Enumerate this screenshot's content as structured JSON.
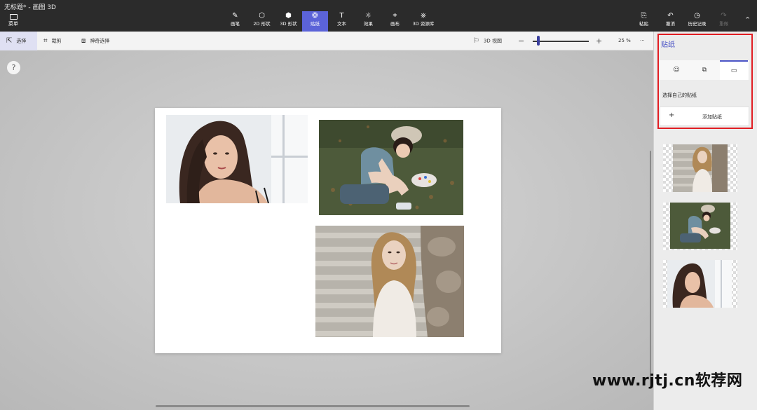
{
  "app": {
    "title": "无标题* - 画图 3D",
    "menu_label": "菜单"
  },
  "toolbar": {
    "tools": [
      {
        "label": "画笔",
        "icon": "brush-icon",
        "glyph": "✎"
      },
      {
        "label": "2D 形状",
        "icon": "shapes-2d-icon",
        "glyph": "⬡"
      },
      {
        "label": "3D 形状",
        "icon": "cube-icon",
        "glyph": "⬢"
      },
      {
        "label": "贴纸",
        "icon": "sticker-icon",
        "glyph": "❂"
      },
      {
        "label": "文本",
        "icon": "text-icon",
        "glyph": "T"
      },
      {
        "label": "效果",
        "icon": "effects-icon",
        "glyph": "☼"
      },
      {
        "label": "画布",
        "icon": "canvas-icon",
        "glyph": "⌗"
      },
      {
        "label": "3D 资源库",
        "icon": "library-3d-icon",
        "glyph": "⎈"
      }
    ],
    "active_tool": "贴纸",
    "right_tools": [
      {
        "label": "粘贴",
        "icon": "paste-icon",
        "glyph": "⎘"
      },
      {
        "label": "撤消",
        "icon": "undo-icon",
        "glyph": "↶"
      },
      {
        "label": "历史记录",
        "icon": "history-icon",
        "glyph": "◷"
      },
      {
        "label": "重做",
        "icon": "redo-icon",
        "glyph": "↷"
      }
    ]
  },
  "subtoolbar": {
    "select_label": "选择",
    "crop_label": "裁剪",
    "magic_select_label": "神奇选择",
    "view_3d_label": "3D 视图",
    "zoom_percent": "25 %",
    "zoom_minus": "−",
    "zoom_plus": "+",
    "more": "···"
  },
  "help": {
    "label": "?"
  },
  "panel": {
    "title": "贴纸",
    "tabs": [
      {
        "name": "stickers",
        "icon": "sticker-tab-icon",
        "glyph": "☺"
      },
      {
        "name": "textures",
        "icon": "texture-tab-icon",
        "glyph": "⧉"
      },
      {
        "name": "custom",
        "icon": "folder-icon",
        "glyph": "▭"
      }
    ],
    "active_tab": "custom",
    "custom_label": "选择自己的贴纸",
    "add_label": "添加贴纸",
    "add_plus": "+"
  },
  "colors": {
    "accent": "#5b63d8",
    "highlight_border": "#e11d23",
    "topbar": "#2b2b2b"
  },
  "watermark": "www.rjtj.cn软荐网"
}
